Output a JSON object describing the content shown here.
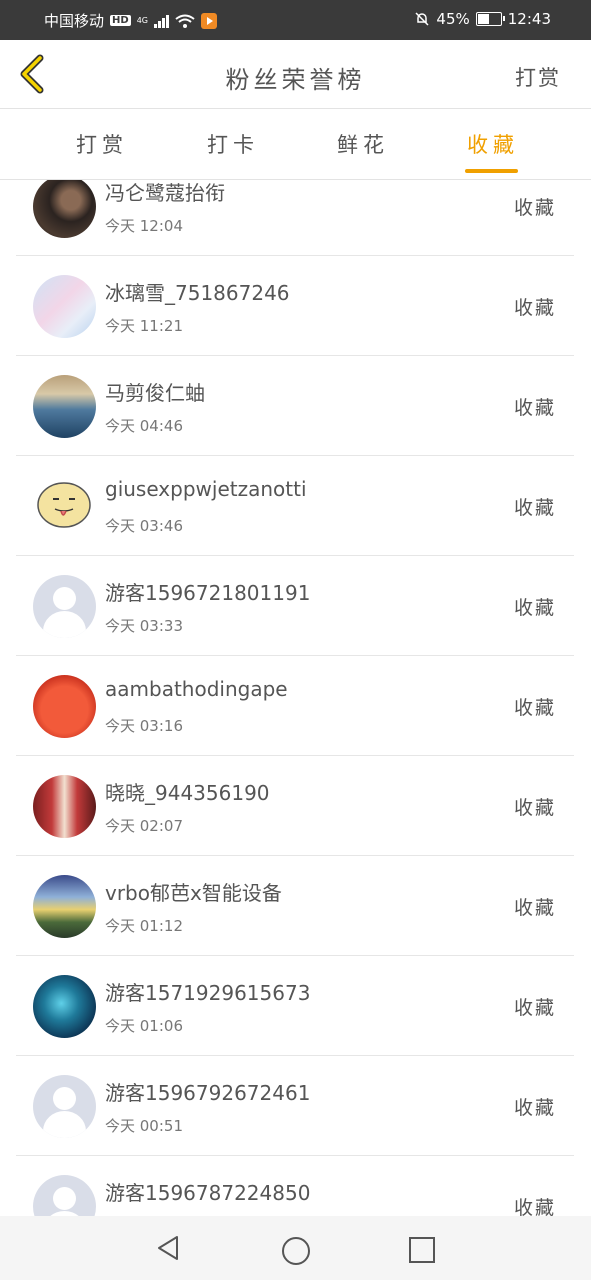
{
  "status_bar": {
    "carrier": "中国移动",
    "hd": "HD",
    "network": "4G",
    "battery": "45%",
    "time": "12:43"
  },
  "header": {
    "title": "粉丝荣誉榜",
    "action": "打赏"
  },
  "tabs": [
    {
      "label": "打赏",
      "active": false
    },
    {
      "label": "打卡",
      "active": false
    },
    {
      "label": "鲜花",
      "active": false
    },
    {
      "label": "收藏",
      "active": true
    }
  ],
  "list": [
    {
      "name": "冯仑鹭蔻抬衔",
      "time": "今天 12:04",
      "action": "收藏",
      "avatar": "photo-dark"
    },
    {
      "name": "冰璃雪_751867246",
      "time": "今天 11:21",
      "action": "收藏",
      "avatar": "photo-anime"
    },
    {
      "name": "马剪俊仁蚰",
      "time": "今天 04:46",
      "action": "收藏",
      "avatar": "photo-sea"
    },
    {
      "name": "giusexppwjetzanotti",
      "time": "今天 03:46",
      "action": "收藏",
      "avatar": "cartoon-face"
    },
    {
      "name": "游客1596721801191",
      "time": "今天 03:33",
      "action": "收藏",
      "avatar": "guest"
    },
    {
      "name": "aambathodingape",
      "time": "今天 03:16",
      "action": "收藏",
      "avatar": "photo-tomato"
    },
    {
      "name": "晓晓_944356190",
      "time": "今天 02:07",
      "action": "收藏",
      "avatar": "photo-child"
    },
    {
      "name": "vrbo郁芭x智能设备",
      "time": "今天 01:12",
      "action": "收藏",
      "avatar": "photo-landscape"
    },
    {
      "name": "游客1571929615673",
      "time": "今天 01:06",
      "action": "收藏",
      "avatar": "photo-galaxy"
    },
    {
      "name": "游客1596792672461",
      "time": "今天 00:51",
      "action": "收藏",
      "avatar": "guest"
    },
    {
      "name": "游客1596787224850",
      "time": "",
      "action": "收藏",
      "avatar": "guest"
    }
  ],
  "colors": {
    "accent": "#f0a000",
    "status_bar": "#3a3a3a"
  },
  "icons": {
    "back": "chevron-left-icon",
    "nav_back": "triangle-back-icon",
    "nav_home": "circle-home-icon",
    "nav_recent": "square-recent-icon"
  }
}
